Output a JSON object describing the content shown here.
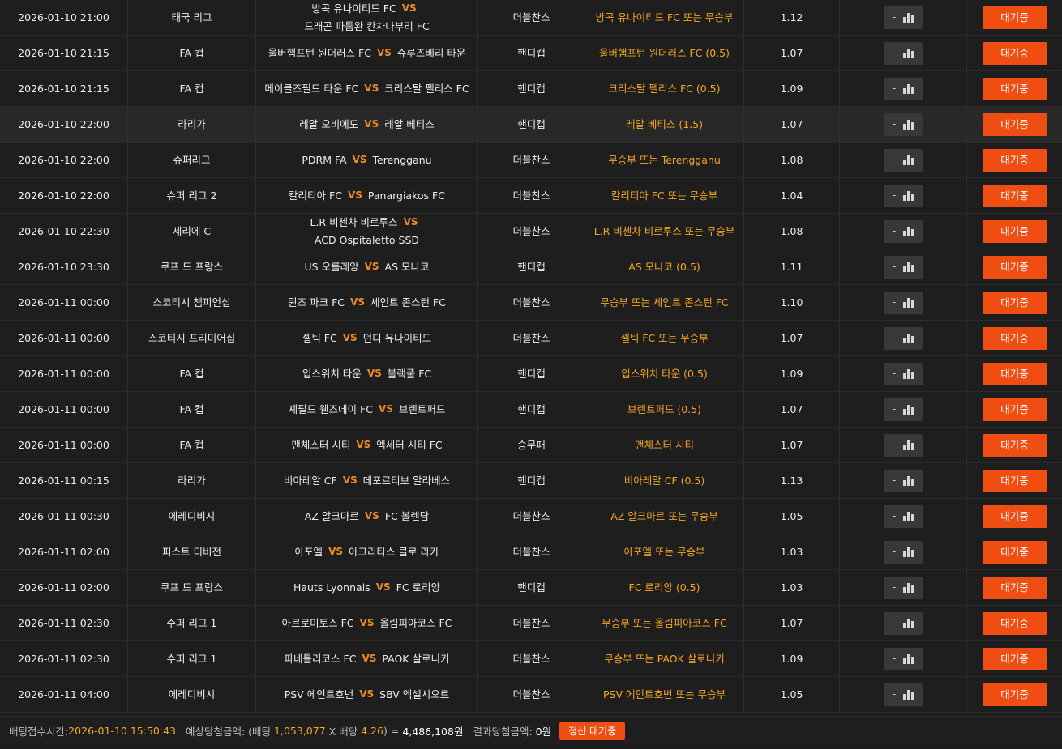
{
  "rows": [
    {
      "date": "2026-01-10 21:00",
      "league": "태국 리그",
      "home": "방콕 유나이티드 FC",
      "away": "드래곤 파툼완 칸차나부리 FC",
      "vs": "VS",
      "type": "더블찬스",
      "pick": "방콕 유나이티드 FC 또는 무승부",
      "odds": "1.12",
      "stat": "-",
      "status": "대기중"
    },
    {
      "date": "2026-01-10 21:15",
      "league": "FA 컵",
      "home": "울버햄프턴 원더러스 FC",
      "away": "슈루즈베리 타운",
      "vs": "VS",
      "type": "핸디캡",
      "pick": "울버햄프턴 원더러스 FC (0.5)",
      "odds": "1.07",
      "stat": "-",
      "status": "대기중"
    },
    {
      "date": "2026-01-10 21:15",
      "league": "FA 컵",
      "home": "메이클즈필드 타운 FC",
      "away": "크리스탈 펠리스 FC",
      "vs": "VS",
      "type": "핸디캡",
      "pick": "크리스탈 펠리스 FC (0.5)",
      "odds": "1.09",
      "stat": "-",
      "status": "대기중"
    },
    {
      "date": "2026-01-10 22:00",
      "league": "라리가",
      "home": "레알 오비에도",
      "away": "레알 베티스",
      "vs": "VS",
      "type": "핸디캡",
      "pick": "레알 베티스 (1.5)",
      "odds": "1.07",
      "stat": "-",
      "status": "대기중"
    },
    {
      "date": "2026-01-10 22:00",
      "league": "슈퍼리그",
      "home": "PDRM FA",
      "away": "Terengganu",
      "vs": "VS",
      "type": "더블찬스",
      "pick": "무승부 또는 Terengganu",
      "odds": "1.08",
      "stat": "-",
      "status": "대기중"
    },
    {
      "date": "2026-01-10 22:00",
      "league": "슈퍼 리그 2",
      "home": "칼리티아 FC",
      "away": "Panargiakos FC",
      "vs": "VS",
      "type": "더블찬스",
      "pick": "칼리티아 FC 또는 무승부",
      "odds": "1.04",
      "stat": "-",
      "status": "대기중"
    },
    {
      "date": "2026-01-10 22:30",
      "league": "세리에 C",
      "home": "L.R 비첸차 비르투스",
      "away": "ACD Ospitaletto SSD",
      "vs": "VS",
      "type": "더블찬스",
      "pick": "L.R 비첸차 비르투스 또는 무승부",
      "odds": "1.08",
      "stat": "-",
      "status": "대기중"
    },
    {
      "date": "2026-01-10 23:30",
      "league": "쿠프 드 프랑스",
      "home": "US 오를레앙",
      "away": "AS 모나코",
      "vs": "VS",
      "type": "핸디캡",
      "pick": "AS 모나코 (0.5)",
      "odds": "1.11",
      "stat": "-",
      "status": "대기중"
    },
    {
      "date": "2026-01-11 00:00",
      "league": "스코티시 챔피언십",
      "home": "퀸즈 파크 FC",
      "away": "세인트 존스턴 FC",
      "vs": "VS",
      "type": "더블찬스",
      "pick": "무승부 또는 세인트 존스턴 FC",
      "odds": "1.10",
      "stat": "-",
      "status": "대기중"
    },
    {
      "date": "2026-01-11 00:00",
      "league": "스코티시 프리미어십",
      "home": "셀틱 FC",
      "away": "던디 유나이티드",
      "vs": "VS",
      "type": "더블찬스",
      "pick": "셀틱 FC 또는 무승부",
      "odds": "1.07",
      "stat": "-",
      "status": "대기중"
    },
    {
      "date": "2026-01-11 00:00",
      "league": "FA 컵",
      "home": "입스위치 타운",
      "away": "블랙풀 FC",
      "vs": "VS",
      "type": "핸디캡",
      "pick": "입스위치 타운 (0.5)",
      "odds": "1.09",
      "stat": "-",
      "status": "대기중"
    },
    {
      "date": "2026-01-11 00:00",
      "league": "FA 컵",
      "home": "셰필드 웬즈데이 FC",
      "away": "브렌트퍼드",
      "vs": "VS",
      "type": "핸디캡",
      "pick": "브렌트퍼드 (0.5)",
      "odds": "1.07",
      "stat": "-",
      "status": "대기중"
    },
    {
      "date": "2026-01-11 00:00",
      "league": "FA 컵",
      "home": "맨체스터 시티",
      "away": "엑세터 시티 FC",
      "vs": "VS",
      "type": "승무패",
      "pick": "맨체스터 시티",
      "odds": "1.07",
      "stat": "-",
      "status": "대기중"
    },
    {
      "date": "2026-01-11 00:15",
      "league": "라리가",
      "home": "비아레알 CF",
      "away": "데포르티보 알라베스",
      "vs": "VS",
      "type": "핸디캡",
      "pick": "비아레알 CF (0.5)",
      "odds": "1.13",
      "stat": "-",
      "status": "대기중"
    },
    {
      "date": "2026-01-11 00:30",
      "league": "에레디비시",
      "home": "AZ 알크마르",
      "away": "FC 볼렌담",
      "vs": "VS",
      "type": "더블찬스",
      "pick": "AZ 알크마르 또는 무승부",
      "odds": "1.05",
      "stat": "-",
      "status": "대기중"
    },
    {
      "date": "2026-01-11 02:00",
      "league": "퍼스트 디비전",
      "home": "아포엘",
      "away": "아크리타스 클로 라카",
      "vs": "VS",
      "type": "더블찬스",
      "pick": "아포엘 또는 무승부",
      "odds": "1.03",
      "stat": "-",
      "status": "대기중"
    },
    {
      "date": "2026-01-11 02:00",
      "league": "쿠프 드 프랑스",
      "home": "Hauts Lyonnais",
      "away": "FC 로리앙",
      "vs": "VS",
      "type": "핸디캡",
      "pick": "FC 로리앙 (0.5)",
      "odds": "1.03",
      "stat": "-",
      "status": "대기중"
    },
    {
      "date": "2026-01-11 02:30",
      "league": "수퍼 리그 1",
      "home": "아르로미토스 FC",
      "away": "올림피아코스 FC",
      "vs": "VS",
      "type": "더블찬스",
      "pick": "무승부 또는 올림피아코스 FC",
      "odds": "1.07",
      "stat": "-",
      "status": "대기중"
    },
    {
      "date": "2026-01-11 02:30",
      "league": "수퍼 리그 1",
      "home": "파네톨리코스 FC",
      "away": "PAOK 살로니키",
      "vs": "VS",
      "type": "더블찬스",
      "pick": "무승부 또는 PAOK 살로니키",
      "odds": "1.09",
      "stat": "-",
      "status": "대기중"
    },
    {
      "date": "2026-01-11 04:00",
      "league": "에레디비시",
      "home": "PSV 에인트호번",
      "away": "SBV 엑셀시오르",
      "vs": "VS",
      "type": "더블찬스",
      "pick": "PSV 에인트호번 또는 무승부",
      "odds": "1.05",
      "stat": "-",
      "status": "대기중"
    }
  ],
  "footer": {
    "bet_time_label": "배팅접수시간:",
    "bet_time": "2026-01-10 15:50:43",
    "expected_label": "예상당첨금액: (배팅",
    "stake": "1,053,077",
    "times": "X 배당",
    "total_odds": "4.26",
    "equals": ") =",
    "expected_amount": "4,486,108원",
    "result_label": "결과당첨금액:",
    "result_amount": "0원",
    "settle_label": "정산 대기중"
  },
  "colors": {
    "accent": "#f04d13",
    "pick": "#f5a623",
    "vs": "#f08a24"
  }
}
